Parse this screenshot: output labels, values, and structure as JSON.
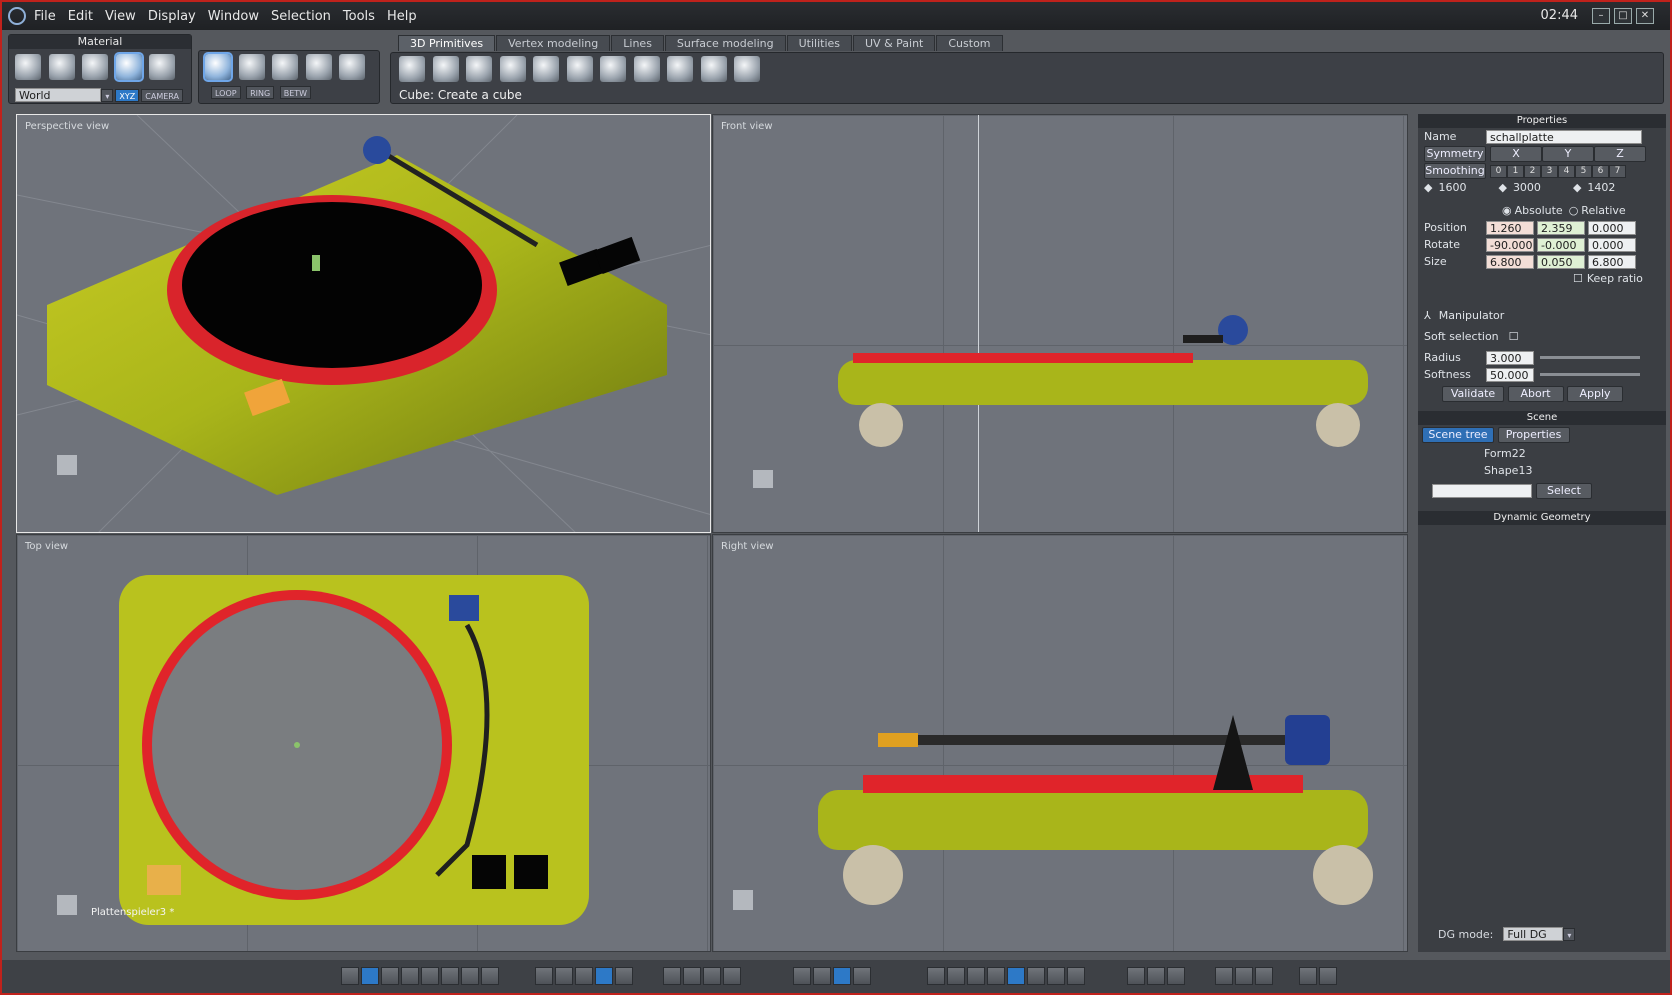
{
  "menubar": {
    "items": [
      "File",
      "Edit",
      "View",
      "Display",
      "Window",
      "Selection",
      "Tools",
      "Help"
    ],
    "clock": "02:44"
  },
  "material_panel": {
    "title": "Material",
    "space_select": "World",
    "chips": [
      "XYZ",
      "CAMERA"
    ]
  },
  "select_panel": {
    "chips": [
      "LOOP",
      "RING",
      "BETW"
    ]
  },
  "tabs": [
    "3D Primitives",
    "Vertex modeling",
    "Lines",
    "Surface modeling",
    "Utilities",
    "UV & Paint",
    "Custom"
  ],
  "active_tab_index": 0,
  "status_hint": "Cube: Create a cube",
  "viewports": {
    "perspective": "Perspective view",
    "front": "Front view",
    "top": "Top view",
    "right": "Right view",
    "object_label": "Plattenspieler3 *"
  },
  "properties": {
    "title": "Properties",
    "name_label": "Name",
    "name_value": "schallplatte",
    "symmetry_label": "Symmetry",
    "axes": [
      "X",
      "Y",
      "Z"
    ],
    "smoothing_label": "Smoothing",
    "smoothing_levels": [
      "0",
      "1",
      "2",
      "3",
      "4",
      "5",
      "6",
      "7"
    ],
    "counts": [
      "1600",
      "3000",
      "1402"
    ],
    "mode_absolute": "Absolute",
    "mode_relative": "Relative",
    "position_label": "Position",
    "position": [
      "1.260",
      "2.359",
      "0.000"
    ],
    "rotate_label": "Rotate",
    "rotate": [
      "-90.000",
      "-0.000",
      "0.000"
    ],
    "size_label": "Size",
    "size": [
      "6.800",
      "0.050",
      "6.800"
    ],
    "keep_ratio": "Keep ratio",
    "manipulator": "Manipulator",
    "soft_selection": "Soft selection",
    "radius_label": "Radius",
    "radius": "3.000",
    "softness_label": "Softness",
    "softness": "50.000",
    "validate": "Validate",
    "abort": "Abort",
    "apply": "Apply"
  },
  "scene": {
    "title": "Scene",
    "tab_tree": "Scene tree",
    "tab_properties": "Properties",
    "items": [
      "Form22",
      "Shape13"
    ],
    "select_button": "Select"
  },
  "dynamic_geometry": {
    "title": "Dynamic Geometry",
    "dg_mode_label": "DG mode:",
    "dg_mode_value": "Full DG"
  },
  "colors": {
    "window_border": "#c0221c",
    "accent": "#2d79c7",
    "viewport_bg": "#6f737b",
    "turntable_yellow": "#b9c21e",
    "platter_red": "#e0242a"
  }
}
